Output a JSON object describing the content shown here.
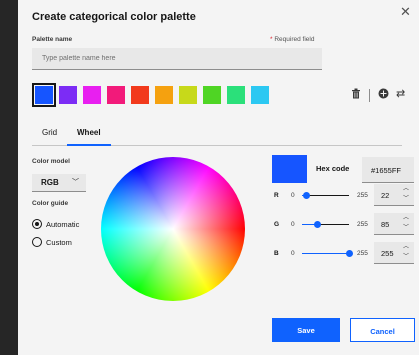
{
  "dialog": {
    "title": "Create categorical color palette",
    "close_icon": "close-icon"
  },
  "palette_name": {
    "label": "Palette name",
    "required_star": "*",
    "required_text": " Required field",
    "placeholder": "Type palette name here",
    "value": ""
  },
  "swatches": [
    "#1655FF",
    "#7C2CF5",
    "#E81FF0",
    "#F21A7A",
    "#F23A1C",
    "#F5A10F",
    "#C7D91A",
    "#4FD524",
    "#2BE07A",
    "#2CC8F2"
  ],
  "selected_swatch_index": 0,
  "toolbar": {
    "delete_icon": "trash-icon",
    "add_icon": "add-circle-icon",
    "swap_icon": "swap-arrows-icon"
  },
  "tabs": [
    {
      "label": "Grid",
      "active": false
    },
    {
      "label": "Wheel",
      "active": true
    }
  ],
  "color_model": {
    "label": "Color model",
    "value": "RGB"
  },
  "color_guide": {
    "label": "Color guide",
    "options": [
      {
        "label": "Automatic",
        "checked": true
      },
      {
        "label": "Custom",
        "checked": false
      }
    ]
  },
  "preview_color": "#1655FF",
  "hex": {
    "label": "Hex code",
    "value": "#1655FF"
  },
  "channels": [
    {
      "name": "R",
      "min": "0",
      "max": "255",
      "value": "22",
      "level": 0.086
    },
    {
      "name": "G",
      "min": "0",
      "max": "255",
      "value": "85",
      "level": 0.333
    },
    {
      "name": "B",
      "min": "0",
      "max": "255",
      "value": "255",
      "level": 1.0
    }
  ],
  "actions": {
    "save": "Save",
    "cancel": "Cancel"
  },
  "colors": {
    "accent": "#0F62FE",
    "left_bar": "#262626",
    "dialog_bg": "#F4F4F4"
  }
}
